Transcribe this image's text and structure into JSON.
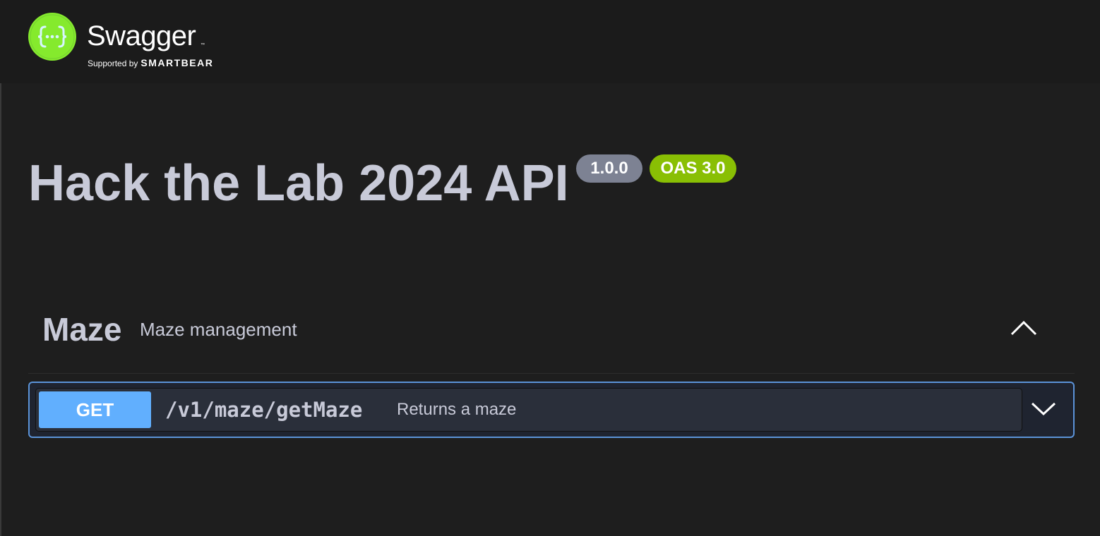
{
  "header": {
    "logo_name": "Swagger",
    "logo_tm": "™",
    "tagline_prefix": "Supported by",
    "tagline_brand": "SMARTBEAR",
    "logo_icon": "braces-dots-icon"
  },
  "info": {
    "title": "Hack the Lab 2024 API",
    "version": "1.0.0",
    "oas": "OAS 3.0"
  },
  "tags": [
    {
      "name": "Maze",
      "description": "Maze management",
      "toggle_icon": "chevron-up-icon",
      "operations": [
        {
          "method": "GET",
          "path": "/v1/maze/getMaze",
          "summary": "Returns a maze",
          "toggle_icon": "chevron-down-icon"
        }
      ]
    }
  ],
  "colors": {
    "logo_green": "#85ea2d",
    "oas_badge": "#89bf04",
    "version_badge": "#7d8293",
    "get_method": "#61affe",
    "get_border": "#5b93d8",
    "text": "#c8cad8",
    "background": "#1e1e1e"
  }
}
